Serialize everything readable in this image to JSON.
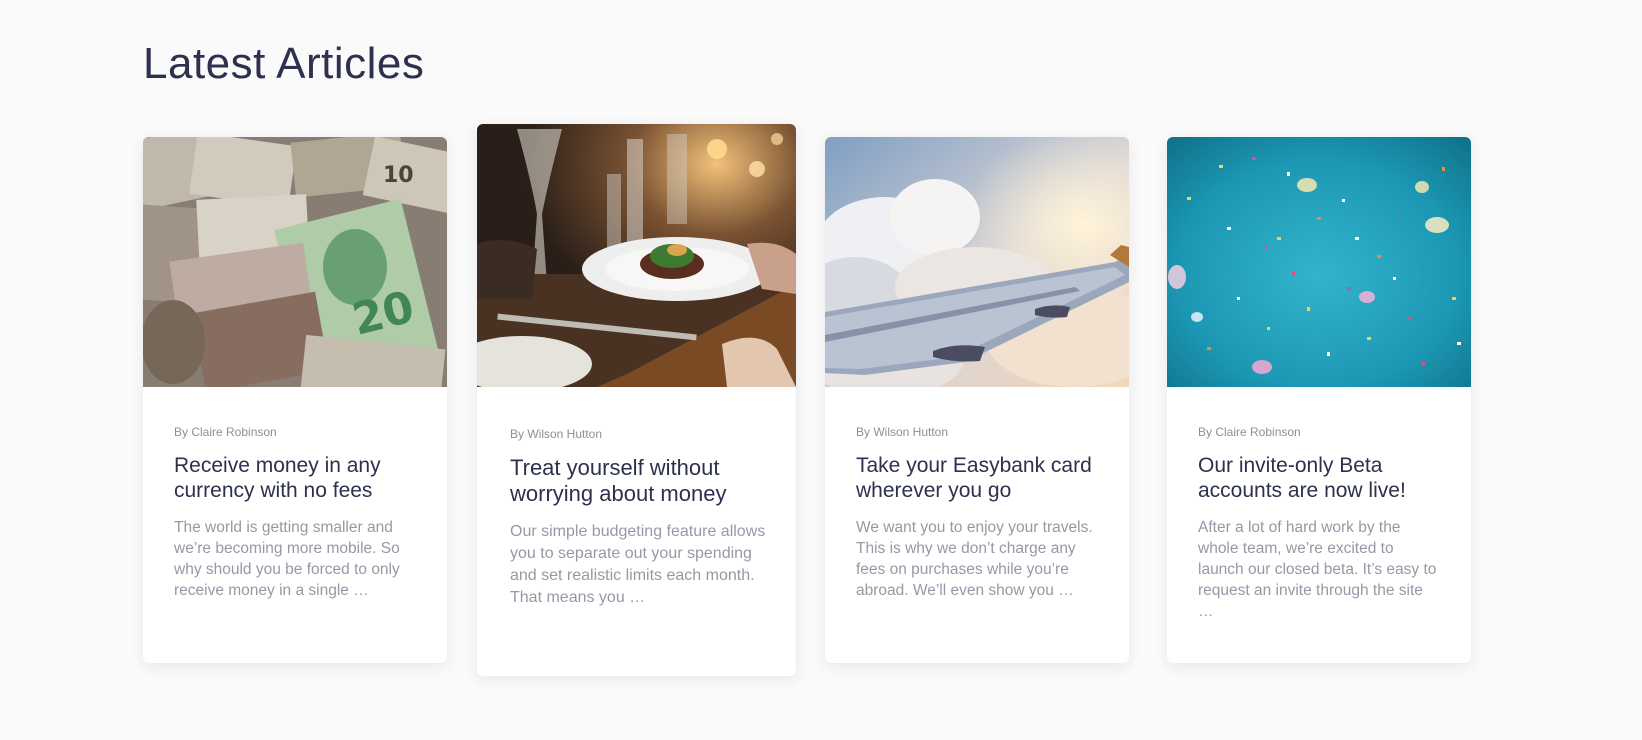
{
  "section": {
    "title": "Latest Articles"
  },
  "articles": [
    {
      "image": "currency-banknotes-photo",
      "author": "By Claire Robinson",
      "title": "Receive money in any currency with no fees",
      "excerpt": "The world is getting smaller and we’re becoming more mobile. So why should you be forced to only receive money in a single …"
    },
    {
      "image": "restaurant-dinner-photo",
      "author": "By Wilson Hutton",
      "title": "Treat yourself without worrying about money",
      "excerpt": "Our simple budgeting feature allows you to separate out your spending and set realistic limits each month. That means you …"
    },
    {
      "image": "airplane-wing-clouds-photo",
      "author": "By Wilson Hutton",
      "title": "Take your Easybank card wherever you go",
      "excerpt": "We want you to enjoy your travels. This is why we don’t charge any fees on purchases while you’re abroad. We’ll even show you …"
    },
    {
      "image": "confetti-photo",
      "author": "By Claire Robinson",
      "title": "Our invite-only Beta accounts are now live!",
      "excerpt": "After a lot of hard work by the whole team, we’re excited to launch our closed beta. It’s easy to request an invite through the site …"
    }
  ],
  "colors": {
    "background": "#fafafa",
    "heading": "#2d314d",
    "author": "#8d8f98",
    "excerpt": "#9698a6",
    "card": "#ffffff"
  }
}
